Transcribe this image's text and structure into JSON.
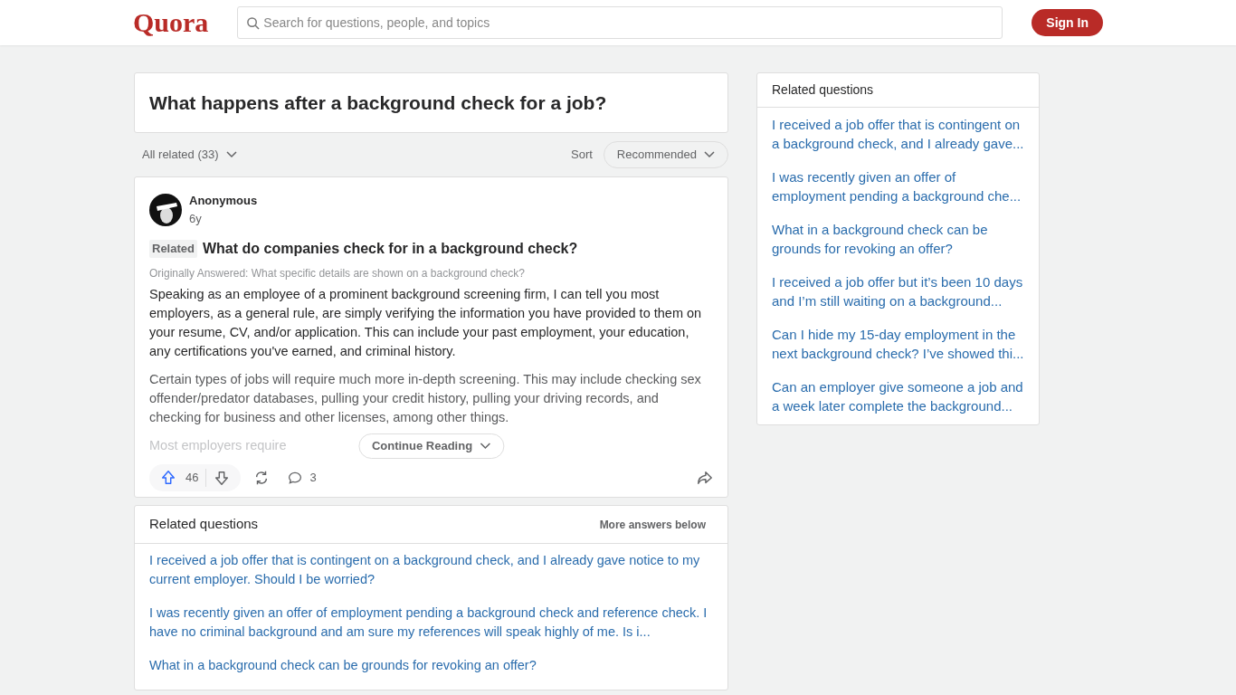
{
  "header": {
    "logo": "Quora",
    "search": {
      "placeholder": "Search for questions, people, and topics"
    },
    "sign_in": "Sign In"
  },
  "question": {
    "title": "What happens after a background check for a job?"
  },
  "filter": {
    "all_related": "All related (33)",
    "sort_label": "Sort",
    "sort_value": "Recommended"
  },
  "answer": {
    "author": "Anonymous",
    "time": "6y",
    "related_tag": "Related",
    "related_question": "What do companies check for in a background check?",
    "originally_answered": "Originally Answered: What specific details are shown on a background check?",
    "paragraphs": [
      "Speaking as an employee of a prominent background screening firm, I can tell you most employers, as a general rule, are simply verifying the information you have provided to them on your resume, CV, and/or application. This can include your past employment, your education, any certifications you've earned, and criminal history.",
      "Certain types of jobs will require much more in-depth screening. This may include checking sex offender/predator databases, pulling your credit history, pulling your driving records, and checking for business and other licenses, among other things.",
      "Most employers require"
    ],
    "continue_reading": "Continue Reading",
    "upvotes": "46",
    "comments": "3"
  },
  "related_questions_main": {
    "title": "Related questions",
    "more": "More answers below",
    "items": [
      "I received a job offer that is contingent on a background check, and I already gave notice to my current employer. Should I be worried?",
      "I was recently given an offer of employment pending a background check and reference check. I have no criminal background and am sure my references will speak highly of me. Is i...",
      "What in a background check can be grounds for revoking an offer?"
    ]
  },
  "related_questions_side": {
    "title": "Related questions",
    "items": [
      "I received a job offer that is contingent on a background check, and I already gave...",
      "I was recently given an offer of employment pending a background che...",
      "What in a background check can be grounds for revoking an offer?",
      "I received a job offer but it’s been 10 days and I’m still waiting on a background...",
      "Can I hide my 15-day employment in the next background check? I’ve showed thi...",
      "Can an employer give someone a job and a week later complete the background..."
    ]
  }
}
